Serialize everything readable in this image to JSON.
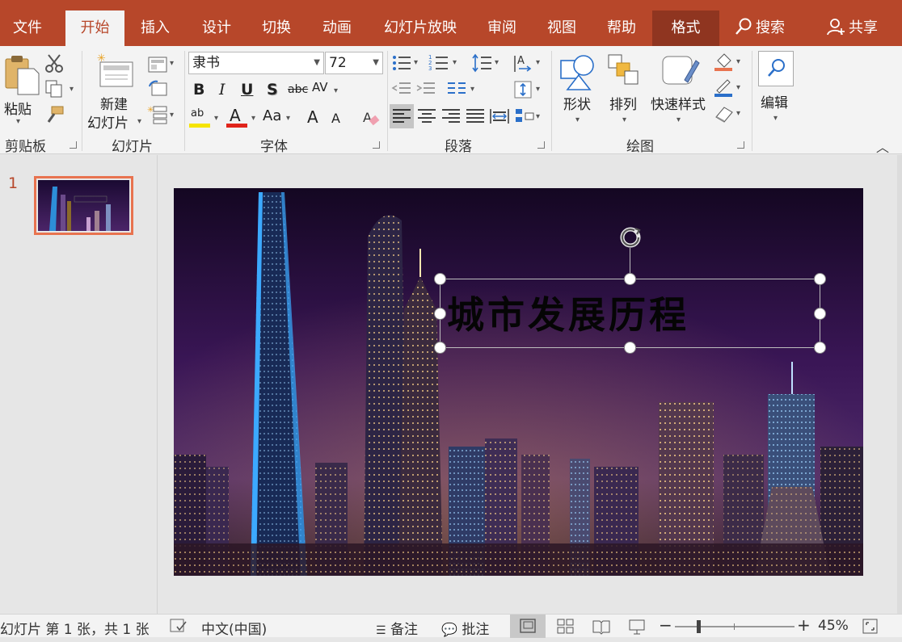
{
  "tabs": {
    "file": "文件",
    "home": "开始",
    "insert": "插入",
    "design": "设计",
    "transitions": "切换",
    "animations": "动画",
    "slideshow": "幻灯片放映",
    "review": "审阅",
    "view": "视图",
    "help": "帮助",
    "format": "格式",
    "search": "搜索",
    "share": "共享"
  },
  "ribbon": {
    "clipboard": {
      "paste": "粘贴",
      "label": "剪贴板"
    },
    "slides": {
      "new_slide_line1": "新建",
      "new_slide_line2": "幻灯片",
      "label": "幻灯片"
    },
    "font": {
      "font_name": "隶书",
      "font_size": "72",
      "bold": "B",
      "italic": "I",
      "underline": "U",
      "shadow": "S",
      "strike": "abc",
      "spacing": "AV",
      "change_case": "Aa",
      "grow": "A",
      "shrink": "A",
      "highlight": "ab",
      "font_color": "A",
      "label": "字体"
    },
    "paragraph": {
      "label": "段落"
    },
    "drawing": {
      "shapes": "形状",
      "arrange": "排列",
      "quick_styles": "快速样式",
      "label": "绘图"
    },
    "editing": {
      "edit": "编辑"
    }
  },
  "thumbnails": [
    {
      "number": "1"
    }
  ],
  "slide": {
    "title": "城市发展历程"
  },
  "status": {
    "slide_info": "幻灯片 第 1 张，共 1 张",
    "language": "中文(中国)",
    "notes": "备注",
    "comments": "批注",
    "zoom": "45%"
  },
  "colors": {
    "accent": "#b7472a",
    "format_tab": "#8f3520",
    "thumb_border": "#e8734f",
    "font_color_bar": "#e0241b",
    "highlight_bar": "#f5e400"
  },
  "zoom_slider": {
    "level": 0.45
  }
}
